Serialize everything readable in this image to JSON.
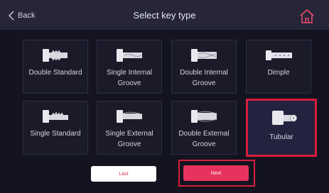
{
  "header": {
    "back_label": "Back",
    "title": "Select key type"
  },
  "key_types": [
    {
      "label_line1": "Double Standard",
      "label_line2": "",
      "icon": "double-standard-key-icon"
    },
    {
      "label_line1": "Single Internal",
      "label_line2": "Groove",
      "icon": "single-internal-groove-key-icon"
    },
    {
      "label_line1": "Double Internal",
      "label_line2": "Groove",
      "icon": "double-internal-groove-key-icon"
    },
    {
      "label_line1": "Dimple",
      "label_line2": "",
      "icon": "dimple-key-icon"
    },
    {
      "label_line1": "Single Standard",
      "label_line2": "",
      "icon": "single-standard-key-icon"
    },
    {
      "label_line1": "Single External",
      "label_line2": "Groove",
      "icon": "single-external-groove-key-icon"
    },
    {
      "label_line1": "Double External",
      "label_line2": "Groove",
      "icon": "double-external-groove-key-icon"
    },
    {
      "label_line1": "Tubular",
      "label_line2": "",
      "icon": "tubular-key-icon",
      "selected": true
    }
  ],
  "buttons": {
    "last_label": "Last",
    "next_label": "Next"
  },
  "colors": {
    "highlight": "#d61e3c",
    "next_button": "#e8325e",
    "background": "#141420",
    "header": "#262638",
    "home_icon": "#e04a6a"
  }
}
